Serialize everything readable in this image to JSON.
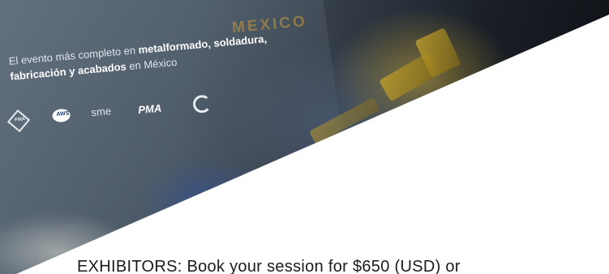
{
  "banner": {
    "event_title": "MEXICO",
    "tagline_parts": {
      "pre": "El evento más completo en ",
      "b1": "metalformado, soldadura, fabricación y acabados",
      "post": " en México"
    },
    "logos": [
      {
        "name": "fma-logo",
        "text": "FMA"
      },
      {
        "name": "aws-logo",
        "text": "AWS"
      },
      {
        "name": "sme-logo",
        "text": "sme"
      },
      {
        "name": "pma-logo",
        "text": "PMA"
      },
      {
        "name": "canacintra-logo",
        "text": ""
      }
    ]
  },
  "cta": {
    "text": "EXHIBITORS: Book your session for $650 (USD) or"
  }
}
